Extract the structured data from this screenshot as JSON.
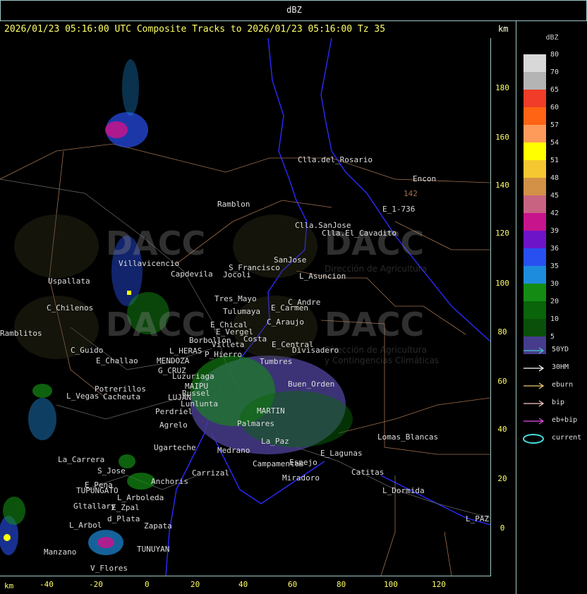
{
  "top": {
    "units": "dBZ"
  },
  "header": {
    "text": "2026/01/23 05:16:00 UTC Composite Tracks to 2026/01/23 05:16:00 Tz 35",
    "km": "km"
  },
  "y_ticks": [
    "180",
    "160",
    "140",
    "120",
    "100",
    "80",
    "60",
    "40",
    "20",
    "0"
  ],
  "x_ticks": [
    "-40",
    "-20",
    "0",
    "20",
    "40",
    "60",
    "80",
    "100",
    "120"
  ],
  "x_unit": "km",
  "legend": {
    "title": "dBZ",
    "scale": [
      {
        "label": "80",
        "color": "#d8d8d8"
      },
      {
        "label": "70",
        "color": "#b4b4b4"
      },
      {
        "label": "65",
        "color": "#f03c28"
      },
      {
        "label": "60",
        "color": "#ff6414"
      },
      {
        "label": "57",
        "color": "#ff9b5a"
      },
      {
        "label": "54",
        "color": "#ffff00"
      },
      {
        "label": "51",
        "color": "#f5c832"
      },
      {
        "label": "48",
        "color": "#d29146"
      },
      {
        "label": "45",
        "color": "#c86482"
      },
      {
        "label": "42",
        "color": "#c8148c"
      },
      {
        "label": "39",
        "color": "#6e14c8"
      },
      {
        "label": "36",
        "color": "#2850f0"
      },
      {
        "label": "35",
        "color": "#1e8cdc"
      },
      {
        "label": "30",
        "color": "#148c14"
      },
      {
        "label": "20",
        "color": "#0a640a"
      },
      {
        "label": "10",
        "color": "#0a500a"
      },
      {
        "label": "5",
        "color": "#463c8c"
      }
    ],
    "tracks": [
      {
        "label": "50YD",
        "color": "#46c8c8"
      },
      {
        "label": "30HM",
        "color": "#ffffff"
      },
      {
        "label": "eburn",
        "color": "#f0c878"
      },
      {
        "label": "bip",
        "color": "#ffc8c8"
      },
      {
        "label": "eb+bip",
        "color": "#e650e6"
      },
      {
        "label": "current",
        "color": "#46dcdc"
      }
    ]
  },
  "watermark": {
    "brand": "DACC",
    "line1": "Dirección de Agricultura",
    "line2": "y Contingencias Climáticas"
  },
  "places": [
    "Clla.del_Rosario",
    "Encon",
    "142",
    "E_1-736",
    "Ramblon",
    "Clla.SanJose",
    "Clla.El_Cavadito",
    "Villavicencio",
    "Capdevila",
    "S_Francisco",
    "Jocoli",
    "SanJose",
    "L_Asuncion",
    "Uspallata",
    "Tres_Mayo",
    "C_Andre",
    "C_Chilenos",
    "Tulumaya",
    "E_Carmen",
    "C_Araujo",
    "E_Chical",
    "E_Vergel",
    "Ramblitos",
    "C_Guido",
    "Borbollon",
    "Villeta",
    "Costa",
    "E_Central",
    "Divisadero",
    "E_Challao",
    "L_HERAS",
    "P_Hierro",
    "MENDOZA",
    "Tumbres",
    "G_CRUZ",
    "Luzuriaga",
    "Russel",
    "MAIPU",
    "Potrerillos",
    "L_Vegas",
    "Cacheuta",
    "LUJAN",
    "Lunlunta",
    "Perdriel",
    "Agrelo",
    "MARTIN",
    "Ugarteche",
    "Lomas_Blancas",
    "La_Carrera",
    "S_Jose",
    "Carrizal",
    "Catitas",
    "E_Pena",
    "TUPUNGATO",
    "Anchoris",
    "L_Arboleda",
    "Miradoro",
    "L_Dormida",
    "Gltallary",
    "E_Zpal",
    "d_Plata",
    "L_Arbol",
    "Zapata",
    "L_PAZ",
    "Manzano",
    "TUNUYAN",
    "V_Flores",
    "Palmares",
    "La_Paz",
    "Medrano",
    "Campamentos",
    "Espejo",
    "E_Lagunas",
    "Buen_Orden"
  ]
}
